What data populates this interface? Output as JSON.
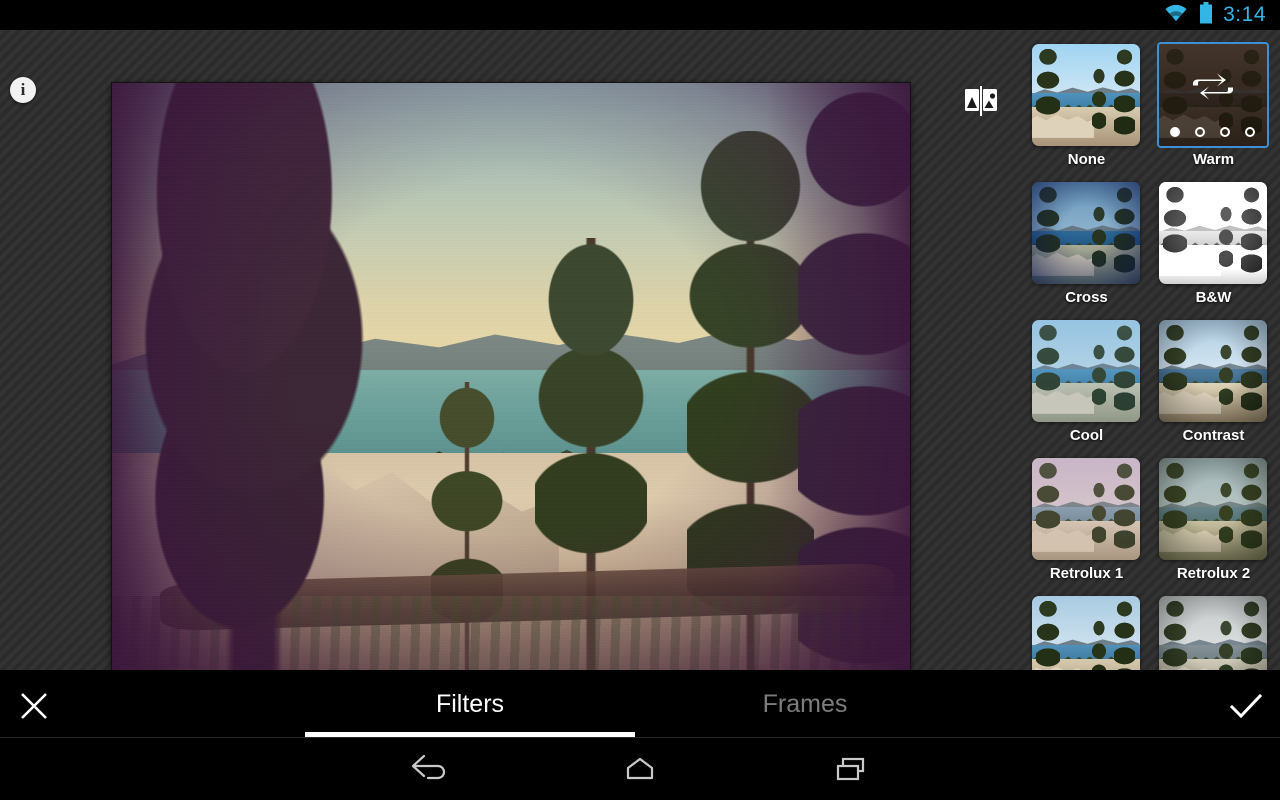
{
  "statusbar": {
    "time": "3:14",
    "wifi_icon": "wifi-icon",
    "battery_icon": "battery-icon"
  },
  "toolbar": {
    "info_icon": "info-icon",
    "info_label": "i",
    "compare_icon": "compare-image-icon"
  },
  "photo": {
    "name": "edited-photo",
    "subject": "Lake Tahoe shoreline with pine trees and granite boulders",
    "applied_filter": "Warm"
  },
  "filters": {
    "selected": "Warm",
    "selected_variant_index": 0,
    "variant_dots": 4,
    "shuffle_icon": "loop-shuffle-icon",
    "items": [
      {
        "label": "None",
        "grade": "g-none",
        "sky_from": "#9fd4f2",
        "sky_to": "#cfe6f5",
        "lake_from": "#4f93bd",
        "lake_to": "#3d7da6",
        "gnd_from": "#d8ccb0",
        "gnd_to": "#a89478",
        "selected": false
      },
      {
        "label": "Warm",
        "grade": "g-warm",
        "sky_from": "#8a7c6a",
        "sky_to": "#6d5f52",
        "lake_from": "#5e5a54",
        "lake_to": "#4c4842",
        "gnd_from": "#8d7f6c",
        "gnd_to": "#5f5446",
        "selected": true
      },
      {
        "label": "Cross",
        "grade": "g-cross",
        "sky_from": "#6f9fc4",
        "sky_to": "#9dc4d8",
        "lake_from": "#2f6f9e",
        "lake_to": "#245b86",
        "gnd_from": "#b9b79a",
        "gnd_to": "#7d8a72",
        "selected": false
      },
      {
        "label": "B&W",
        "grade": "g-bw",
        "sky_from": "#e8e8e8",
        "sky_to": "#f4f4f4",
        "lake_from": "#9a9a9a",
        "lake_to": "#868686",
        "gnd_from": "#d2d2d2",
        "gnd_to": "#8e8e8e",
        "selected": false
      },
      {
        "label": "Cool",
        "grade": "g-cool",
        "sky_from": "#9ecbe6",
        "sky_to": "#c6e0ee",
        "lake_from": "#4f94bd",
        "lake_to": "#3f7ea6",
        "gnd_from": "#cfcbb0",
        "gnd_to": "#9d9a7c",
        "selected": false
      },
      {
        "label": "Contrast",
        "grade": "g-contrast",
        "sky_from": "#a8c8e0",
        "sky_to": "#d4e6f2",
        "lake_from": "#43749a",
        "lake_to": "#33607f",
        "gnd_from": "#ddd1b2",
        "gnd_to": "#a08e70",
        "selected": false
      },
      {
        "label": "Retrolux 1",
        "grade": "g-retro1",
        "sky_from": "#c6b8cc",
        "sky_to": "#dcd2d8",
        "lake_from": "#7d9fb4",
        "lake_to": "#6b8ca0",
        "gnd_from": "#ded3bc",
        "gnd_to": "#ab9c84",
        "selected": false
      },
      {
        "label": "Retrolux 2",
        "grade": "g-retro2",
        "sky_from": "#9db4c0",
        "sky_to": "#b8c8cc",
        "lake_from": "#5b7f8c",
        "lake_to": "#4a6b76",
        "gnd_from": "#c8c0a4",
        "gnd_to": "#8e8a6c",
        "selected": false
      },
      {
        "label": "",
        "grade": "g-none",
        "sky_from": "#a8cbe2",
        "sky_to": "#cfe2ee",
        "lake_from": "#5190b8",
        "lake_to": "#3f7ba2",
        "gnd_from": "#d6caae",
        "gnd_to": "#a69276",
        "selected": false
      },
      {
        "label": "",
        "grade": "g-contrast",
        "sky_from": "#c2c6c6",
        "sky_to": "#d8dcdc",
        "lake_from": "#7d8c92",
        "lake_to": "#6b7a80",
        "gnd_from": "#cdc8b4",
        "gnd_to": "#9a9484",
        "selected": false
      }
    ]
  },
  "tabs": {
    "filters_label": "Filters",
    "frames_label": "Frames",
    "active": "Filters",
    "close_icon": "close-x-icon",
    "confirm_icon": "check-icon"
  },
  "navbar": {
    "back_icon": "back-arrow-icon",
    "home_icon": "home-icon",
    "recents_icon": "recent-apps-icon"
  },
  "colors": {
    "accent_blue": "#33b5e5",
    "selection_blue": "#3d8fd6",
    "bar_black": "#000000",
    "workspace_gray": "#2f2f2f"
  }
}
